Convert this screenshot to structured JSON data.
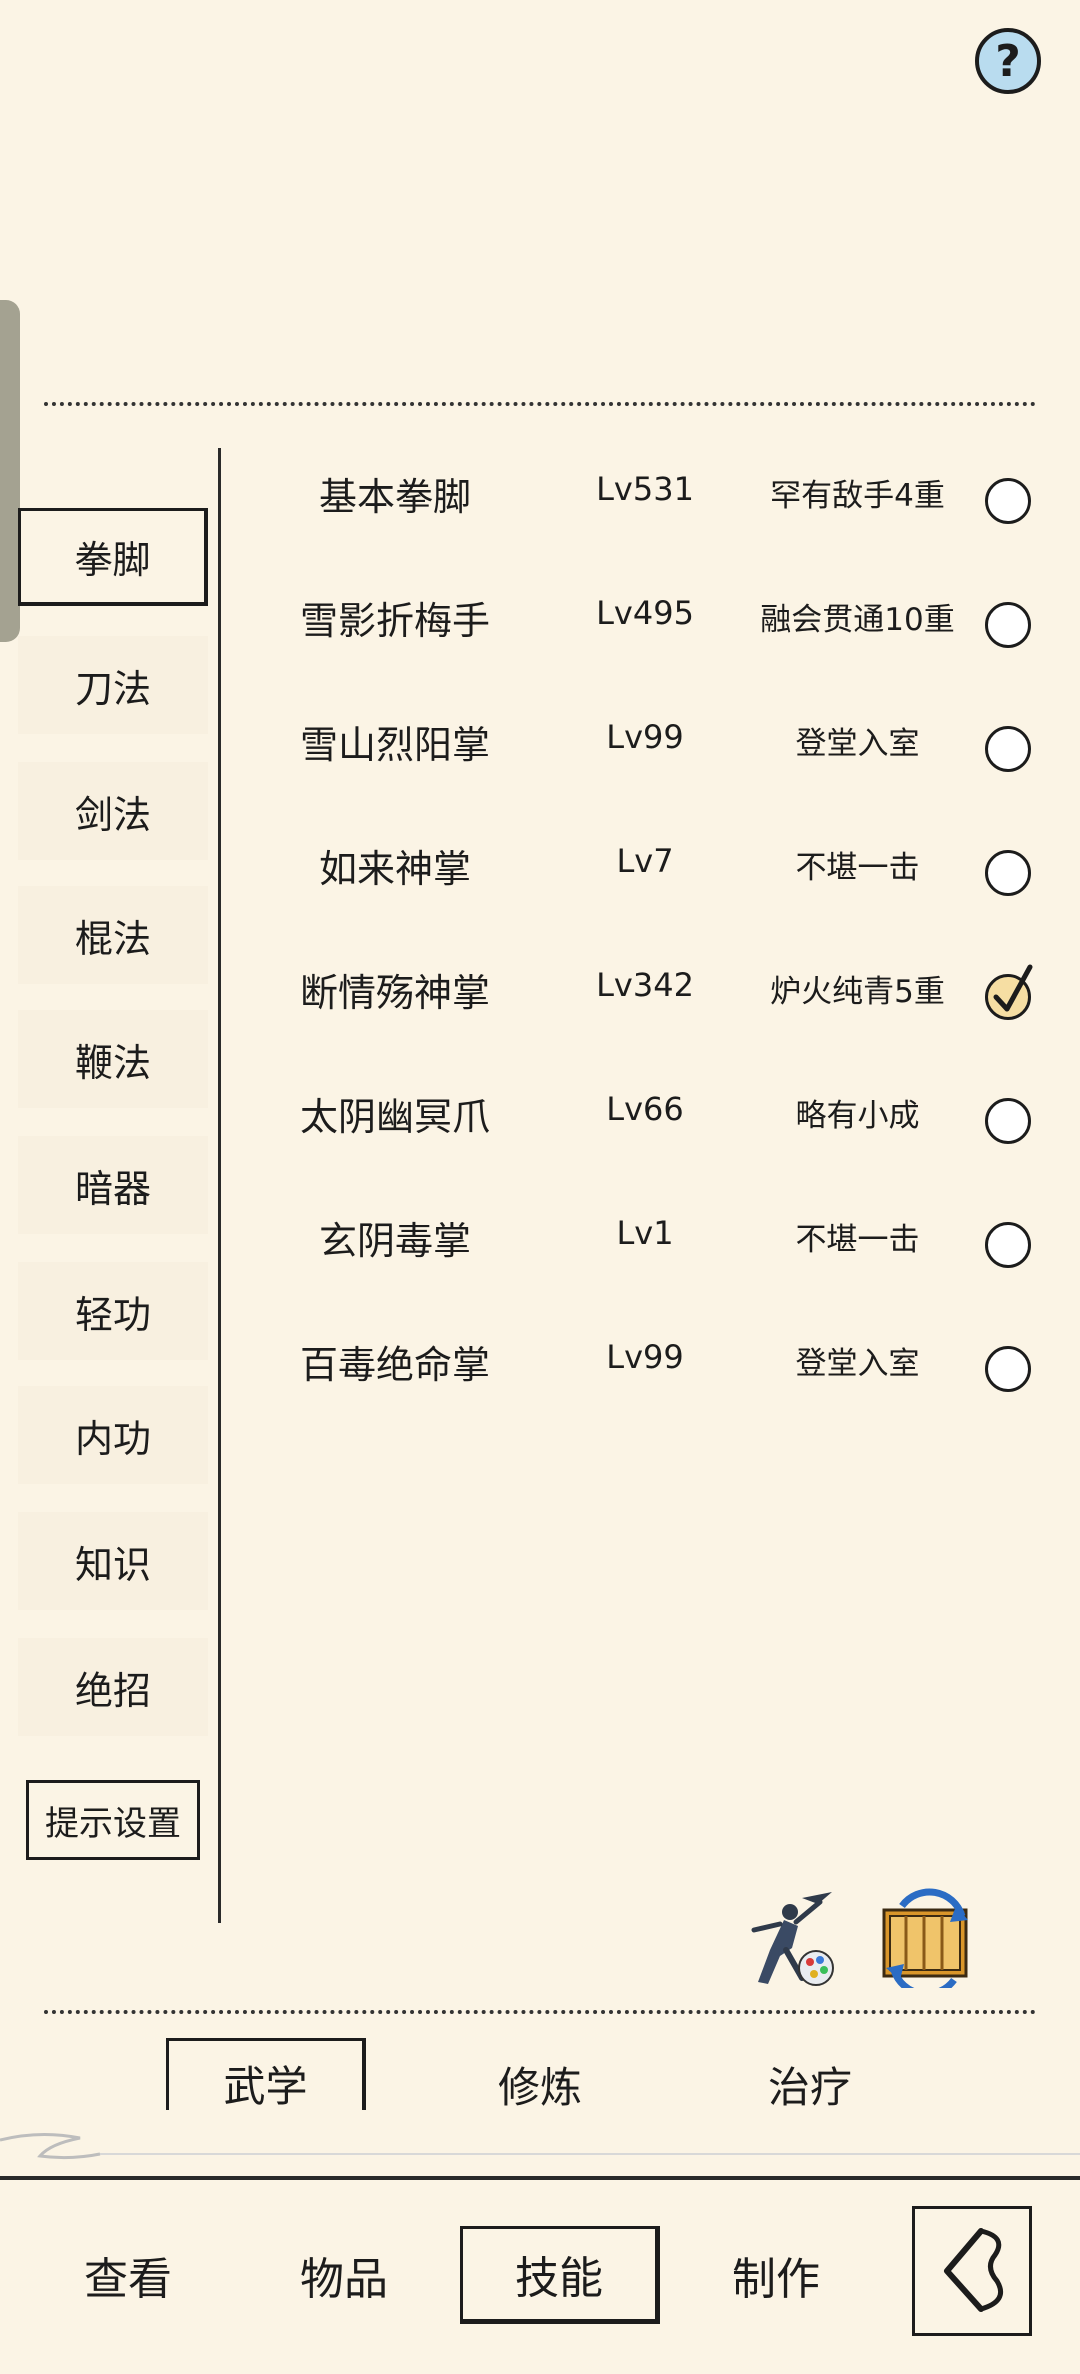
{
  "help": {
    "glyph": "?"
  },
  "categories": [
    {
      "label": "拳脚"
    },
    {
      "label": "刀法"
    },
    {
      "label": "剑法"
    },
    {
      "label": "棍法"
    },
    {
      "label": "鞭法"
    },
    {
      "label": "暗器"
    },
    {
      "label": "轻功"
    },
    {
      "label": "内功"
    },
    {
      "label": "知识"
    },
    {
      "label": "绝招"
    }
  ],
  "hint_settings_label": "提示设置",
  "skills": [
    {
      "name": "基本拳脚",
      "level": "Lv531",
      "rank": "罕有敌手4重",
      "checked": false
    },
    {
      "name": "雪影折梅手",
      "level": "Lv495",
      "rank": "融会贯通10重",
      "checked": false
    },
    {
      "name": "雪山烈阳掌",
      "level": "Lv99",
      "rank": "登堂入室",
      "checked": false
    },
    {
      "name": "如来神掌",
      "level": "Lv7",
      "rank": "不堪一击",
      "checked": false
    },
    {
      "name": "断情殇神掌",
      "level": "Lv342",
      "rank": "炉火纯青5重",
      "checked": true
    },
    {
      "name": "太阴幽冥爪",
      "level": "Lv66",
      "rank": "略有小成",
      "checked": false
    },
    {
      "name": "玄阴毒掌",
      "level": "Lv1",
      "rank": "不堪一击",
      "checked": false
    },
    {
      "name": "百毒绝命掌",
      "level": "Lv99",
      "rank": "登堂入室",
      "checked": false
    }
  ],
  "sub_tabs": [
    {
      "label": "武学"
    },
    {
      "label": "修炼"
    },
    {
      "label": "治疗"
    }
  ],
  "nav": [
    {
      "label": "查看"
    },
    {
      "label": "物品"
    },
    {
      "label": "技能"
    },
    {
      "label": "制作"
    }
  ],
  "colors": {
    "background": "#fbf4e5",
    "ink": "#1c1c1c",
    "help_blue": "#b9dcef",
    "check_fill": "#f6dea3"
  },
  "icons": {
    "help": "question-icon",
    "martial": "martial-artist-icon",
    "swap": "swap-scroll-icon",
    "back": "back-arrow-icon"
  }
}
